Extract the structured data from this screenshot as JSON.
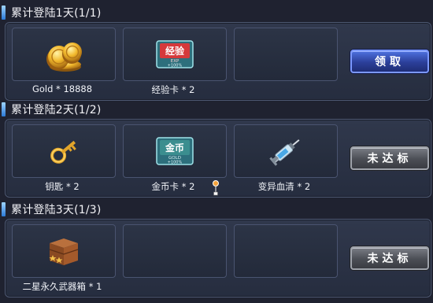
{
  "sections": [
    {
      "title": "累计登陆1天(1/1)",
      "items": [
        {
          "label": "Gold * 18888",
          "icon": "gold-coins-icon"
        },
        {
          "label": "经验卡 * 2",
          "icon": "exp-card-icon",
          "card_text": "经验",
          "card_sub": "EXP",
          "card_pct": "+100%"
        }
      ],
      "button": {
        "label": "领取",
        "state": "claimable"
      }
    },
    {
      "title": "累计登陆2天(1/2)",
      "items": [
        {
          "label": "钥匙 * 2",
          "icon": "key-icon"
        },
        {
          "label": "金币卡 * 2",
          "icon": "gold-card-icon",
          "card_text": "金币",
          "card_sub": "GOLD",
          "card_pct": "+100%"
        },
        {
          "label": "变异血清 * 2",
          "icon": "serum-syringe-icon"
        }
      ],
      "button": {
        "label": "未达标",
        "state": "not-reached"
      }
    },
    {
      "title": "累计登陆3天(1/3)",
      "items": [
        {
          "label": "二星永久武器箱 * 1",
          "icon": "weapon-crate-icon"
        }
      ],
      "button": {
        "label": "未达标",
        "state": "not-reached"
      }
    }
  ],
  "colors": {
    "background": "#1f2230",
    "claim_button": "#2b3f9a",
    "disabled_button": "#4b4e55",
    "title_marker": "#2b79d6"
  }
}
